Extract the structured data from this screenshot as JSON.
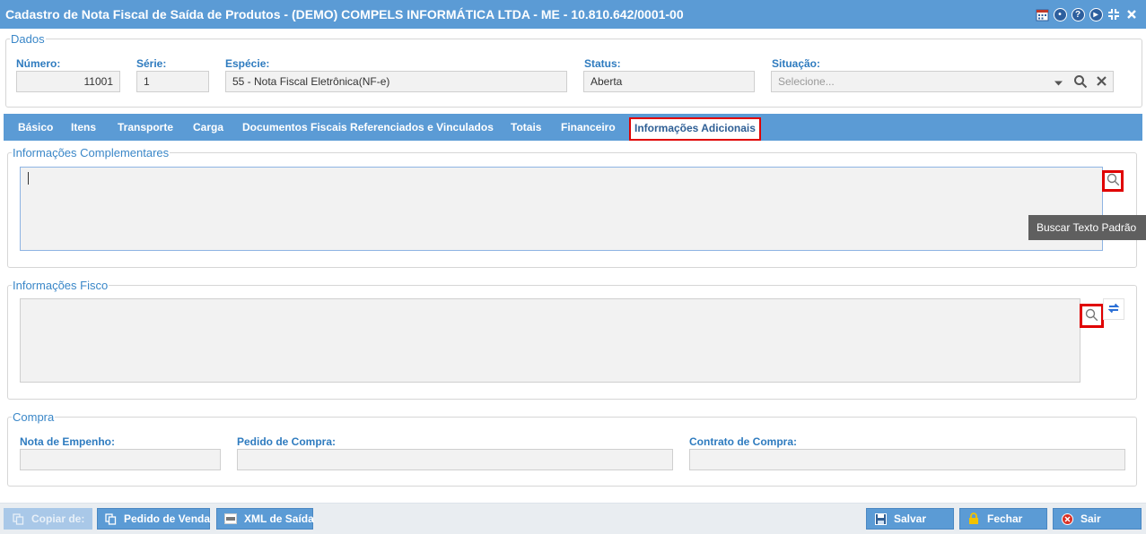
{
  "window": {
    "title": "Cadastro de Nota Fiscal de Saída de Produtos - (DEMO) COMPELS INFORMÁTICA LTDA - ME - 10.810.642/0001-00",
    "icons": [
      "calendar-icon",
      "chat-icon",
      "help-icon",
      "play-icon",
      "collapse-icon",
      "close-icon"
    ]
  },
  "dados": {
    "legend": "Dados",
    "numero": {
      "label": "Número:",
      "value": "11001"
    },
    "serie": {
      "label": "Série:",
      "value": "1"
    },
    "especie": {
      "label": "Espécie:",
      "value": "55 - Nota Fiscal Eletrônica(NF-e)"
    },
    "status": {
      "label": "Status:",
      "value": "Aberta"
    },
    "situacao": {
      "label": "Situação:",
      "placeholder": "Selecione..."
    }
  },
  "tabs": [
    {
      "label": "Básico"
    },
    {
      "label": "Itens"
    },
    {
      "label": "Transporte"
    },
    {
      "label": "Carga"
    },
    {
      "label": "Documentos Fiscais Referenciados e Vinculados"
    },
    {
      "label": "Totais"
    },
    {
      "label": "Financeiro"
    },
    {
      "label": "Informações Adicionais",
      "active": true
    }
  ],
  "complementares": {
    "legend": "Informações Complementares",
    "value": ""
  },
  "tooltip": "Buscar Texto Padrão",
  "fisco": {
    "legend": "Informações Fisco",
    "value": ""
  },
  "compra": {
    "legend": "Compra",
    "nota_empenho": {
      "label": "Nota de Empenho:",
      "value": ""
    },
    "pedido_compra": {
      "label": "Pedido de Compra:",
      "value": ""
    },
    "contrato_compra": {
      "label": "Contrato de Compra:",
      "value": ""
    }
  },
  "footer": {
    "copiar": "Copiar de:",
    "pedido_venda": "Pedido de Venda",
    "xml_saida": "XML de Saída",
    "salvar": "Salvar",
    "fechar": "Fechar",
    "sair": "Sair"
  },
  "colors": {
    "accent": "#5b9bd5",
    "label": "#2e7bbf",
    "highlight": "#e00000"
  }
}
